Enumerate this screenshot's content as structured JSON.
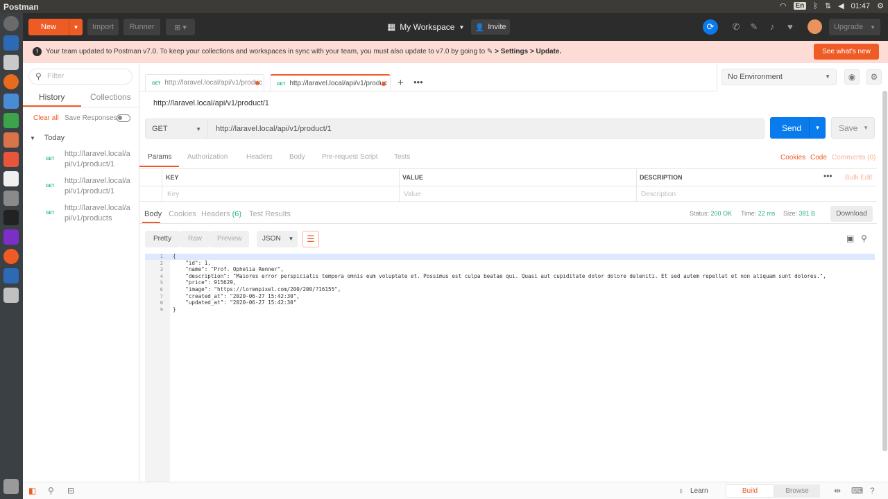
{
  "os": {
    "app_title": "Postman",
    "lang": "En",
    "clock": "01:47"
  },
  "header": {
    "new_label": "New",
    "import_label": "Import",
    "runner_label": "Runner",
    "workspace_label": "My Workspace",
    "invite_label": "Invite",
    "upgrade_label": "Upgrade"
  },
  "banner": {
    "message": "Your team updated to Postman v7.0. To keep your collections and workspaces in sync with your team, you must also update to v7.0 by going to",
    "message_bold": "> Settings > Update.",
    "cta": "See what's new"
  },
  "sidebar": {
    "filter_placeholder": "Filter",
    "tab_history": "History",
    "tab_collections": "Collections",
    "clear_all": "Clear all",
    "save_responses": "Save Responses",
    "group_today": "Today",
    "history": [
      {
        "method": "GET",
        "url": "http://laravel.local/api/v1/product/1"
      },
      {
        "method": "GET",
        "url": "http://laravel.local/api/v1/product/1"
      },
      {
        "method": "GET",
        "url": "http://laravel.local/api/v1/products"
      }
    ]
  },
  "tabs": [
    {
      "method": "GET",
      "label": "http://laravel.local/api/v1/produc"
    },
    {
      "method": "GET",
      "label": "http://laravel.local/api/v1/produc"
    }
  ],
  "environment": {
    "selected": "No Environment"
  },
  "request": {
    "name": "http://laravel.local/api/v1/product/1",
    "method": "GET",
    "url": "http://laravel.local/api/v1/product/1",
    "send_label": "Send",
    "save_label": "Save",
    "tabs": [
      "Params",
      "Authorization",
      "Headers",
      "Body",
      "Pre-request Script",
      "Tests"
    ],
    "cookies": "Cookies",
    "code": "Code",
    "comments": "Comments (0)"
  },
  "params": {
    "headers": [
      "KEY",
      "VALUE",
      "DESCRIPTION"
    ],
    "placeholders": [
      "Key",
      "Value",
      "Description"
    ],
    "bulk_edit": "Bulk Edit"
  },
  "response": {
    "tabs": {
      "body": "Body",
      "cookies": "Cookies",
      "headers": "Headers",
      "headers_count": "(6)",
      "test_results": "Test Results"
    },
    "status_label": "Status:",
    "status_value": "200 OK",
    "time_label": "Time:",
    "time_value": "22 ms",
    "size_label": "Size:",
    "size_value": "381 B",
    "download": "Download",
    "views": [
      "Pretty",
      "Raw",
      "Preview"
    ],
    "format": "JSON",
    "lines": [
      "{",
      "    \"id\": 1,",
      "    \"name\": \"Prof. Ophelia Renner\",",
      "    \"description\": \"Maiores error perspiciatis tempora omnis eum voluptate et. Possimus est culpa beatae qui. Quasi aut cupiditate dolor dolore deleniti. Et sed autem repellat et non aliquam sunt dolores.\",",
      "    \"price\": 915629,",
      "    \"image\": \"https://lorempixel.com/200/200/?16155\",",
      "    \"created_at\": \"2020-06-27 15:42:30\",",
      "    \"updated_at\": \"2020-06-27 15:42:30\"",
      "}"
    ],
    "line_numbers": [
      "1",
      "2",
      "3",
      "4",
      "5",
      "6",
      "7",
      "8",
      "9"
    ]
  },
  "statusbar": {
    "learn": "Learn",
    "build": "Build",
    "browse": "Browse"
  },
  "colors": {
    "accent": "#ef5b25",
    "send_blue": "#097bed",
    "get_green": "#26b47f"
  }
}
